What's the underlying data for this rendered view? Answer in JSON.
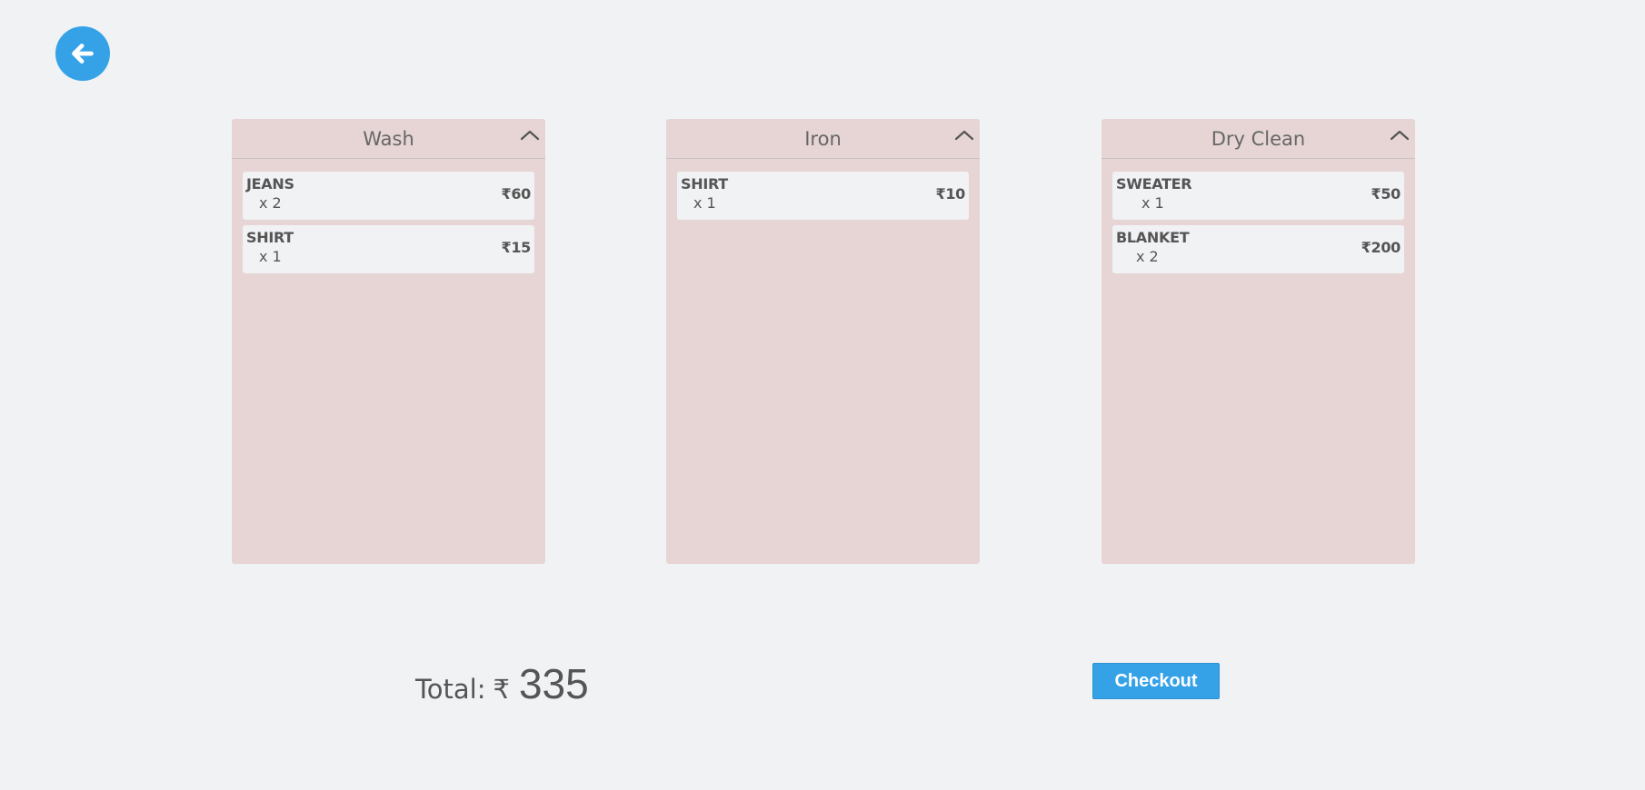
{
  "back_button": {
    "icon": "arrow-left-icon",
    "color": "#35a2e8"
  },
  "panels": [
    {
      "title": "Wash",
      "items": [
        {
          "name": "JEANS",
          "qty": "x 2",
          "price": "₹60"
        },
        {
          "name": "SHIRT",
          "qty": "x 1",
          "price": "₹15"
        }
      ]
    },
    {
      "title": "Iron",
      "items": [
        {
          "name": "SHIRT",
          "qty": "x 1",
          "price": "₹10"
        }
      ]
    },
    {
      "title": "Dry Clean",
      "items": [
        {
          "name": "SWEATER",
          "qty": "x 1",
          "price": "₹50"
        },
        {
          "name": "BLANKET",
          "qty": "x 2",
          "price": "₹200"
        }
      ]
    }
  ],
  "total": {
    "label": "Total:",
    "currency": "₹",
    "value": "335"
  },
  "checkout": {
    "label": "Checkout",
    "color": "#35a2e8"
  },
  "colors": {
    "background": "#f1f2f4",
    "panel": "#e7d5d5",
    "text": "#555555"
  }
}
